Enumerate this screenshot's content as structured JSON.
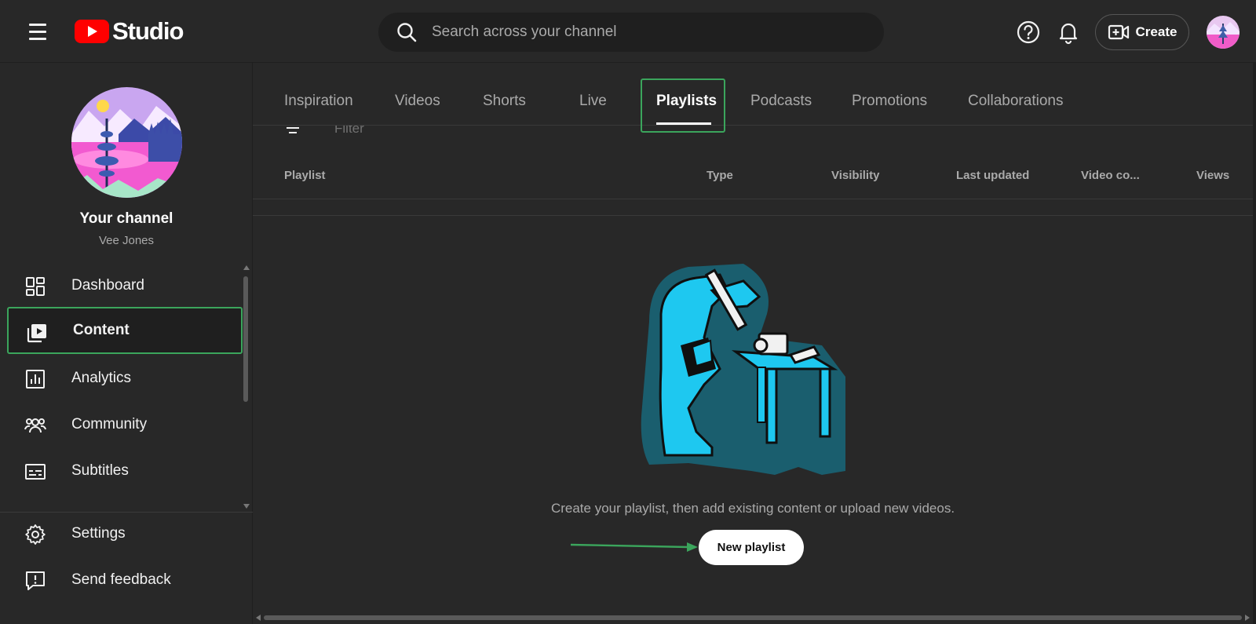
{
  "app": {
    "logo_text": "Studio",
    "search_placeholder": "Search across your channel",
    "create_label": "Create"
  },
  "sidebar": {
    "channel_title": "Your channel",
    "channel_name": "Vee Jones",
    "items": [
      {
        "label": "Dashboard",
        "icon": "dashboard-icon"
      },
      {
        "label": "Content",
        "icon": "content-icon",
        "active": true
      },
      {
        "label": "Analytics",
        "icon": "analytics-icon"
      },
      {
        "label": "Community",
        "icon": "community-icon"
      },
      {
        "label": "Subtitles",
        "icon": "subtitles-icon"
      }
    ],
    "footer_items": [
      {
        "label": "Settings",
        "icon": "gear-icon"
      },
      {
        "label": "Send feedback",
        "icon": "feedback-icon"
      }
    ]
  },
  "main": {
    "tabs": [
      {
        "label": "Inspiration"
      },
      {
        "label": "Videos"
      },
      {
        "label": "Shorts"
      },
      {
        "label": "Live"
      },
      {
        "label": "Playlists",
        "active": true
      },
      {
        "label": "Podcasts"
      },
      {
        "label": "Promotions"
      },
      {
        "label": "Collaborations"
      }
    ],
    "filter_placeholder": "Filter",
    "columns": [
      {
        "label": "Playlist"
      },
      {
        "label": "Type"
      },
      {
        "label": "Visibility"
      },
      {
        "label": "Last updated"
      },
      {
        "label": "Video co..."
      },
      {
        "label": "Views"
      }
    ],
    "empty_state_text": "Create your playlist, then add existing content or upload new videos.",
    "new_playlist_label": "New playlist"
  },
  "colors": {
    "background": "#282828",
    "highlight_annotation": "#3ba55c",
    "brand_red": "#ff0000",
    "illustration_cyan": "#1ec8f0",
    "illustration_teal": "#1a5e6e"
  }
}
